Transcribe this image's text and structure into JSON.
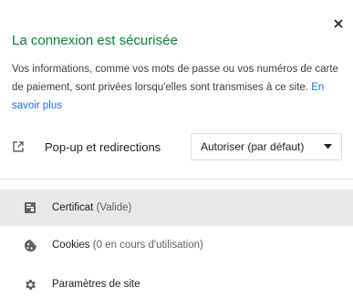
{
  "panel": {
    "title": "La connexion est sécurisée",
    "description": "Vos informations, comme vos mots de passe ou vos numéros de carte de paiement, sont privées lorsqu'elles sont transmises à ce site.",
    "learn_more": "En savoir plus",
    "popup_label": "Pop-up et redirections",
    "popup_value": "Autoriser (par défaut)",
    "items": [
      {
        "label": "Certificat",
        "detail": "(Valide)",
        "icon": "certificate-icon"
      },
      {
        "label": "Cookies",
        "detail": "(0 en cours d'utilisation)",
        "icon": "cookie-icon"
      },
      {
        "label": "Paramètres de site",
        "detail": "",
        "icon": "gear-icon"
      }
    ],
    "colors": {
      "title": "#0b8043",
      "link": "#1a73e8",
      "highlight": "#e8e8e8"
    }
  }
}
